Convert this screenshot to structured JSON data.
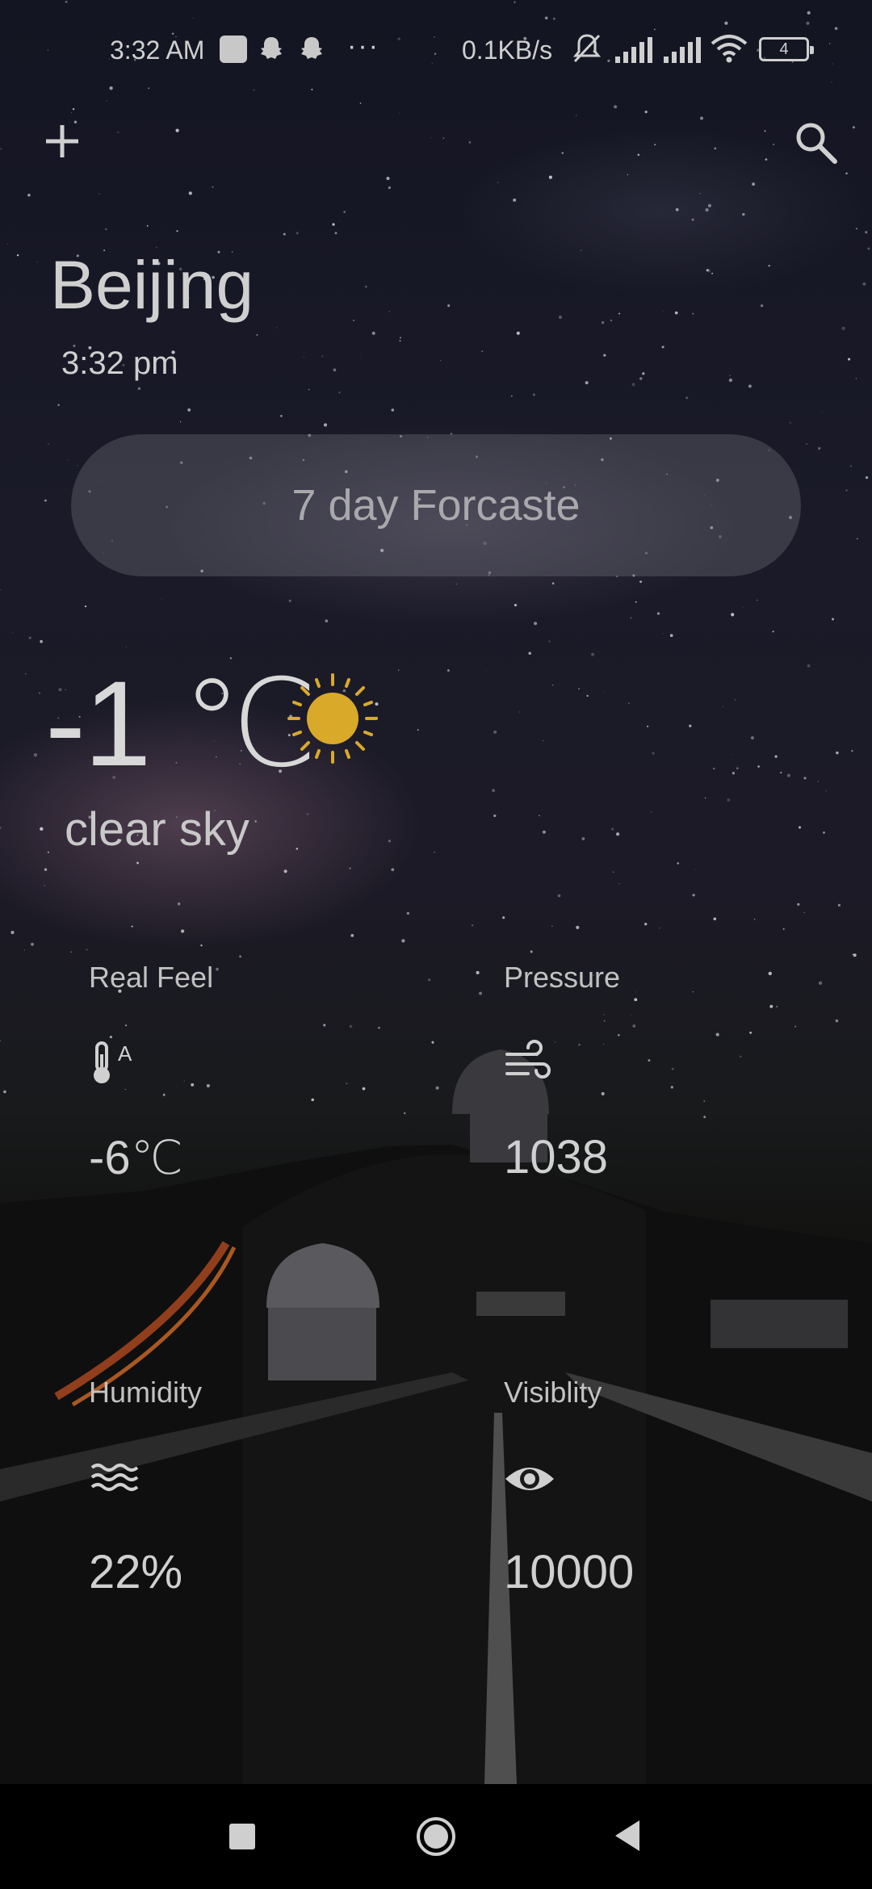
{
  "status_bar": {
    "time": "3:32 AM",
    "dots": "···",
    "net_speed": "0.1KB/s",
    "battery": "4",
    "icons": [
      "notification-square-icon",
      "snapchat-icon",
      "snapchat-icon",
      "mute-icon",
      "signal-icon",
      "signal-icon",
      "wifi-icon",
      "battery-icon"
    ]
  },
  "header": {
    "add_icon": "plus-icon",
    "search_icon": "search-icon"
  },
  "location": {
    "city": "Beijing",
    "local_time": "3:32 pm"
  },
  "forecast_button": {
    "label": "7 day Forcaste"
  },
  "current": {
    "temperature": "-1 ℃",
    "icon": "sun-icon",
    "icon_color": "#d9a92a",
    "description": "clear sky"
  },
  "stats": {
    "real_feel": {
      "label": "Real Feel",
      "icon": "thermometer-icon",
      "value": "-6℃"
    },
    "pressure": {
      "label": "Pressure",
      "icon": "wind-icon",
      "value": "1038"
    },
    "humidity": {
      "label": "Humidity",
      "icon": "humidity-waves-icon",
      "value": "22%"
    },
    "visibility": {
      "label": "Visiblity",
      "icon": "eye-icon",
      "value": "10000"
    }
  },
  "nav_bar": {
    "icons": [
      "recent-apps-icon",
      "home-icon",
      "back-icon"
    ]
  }
}
